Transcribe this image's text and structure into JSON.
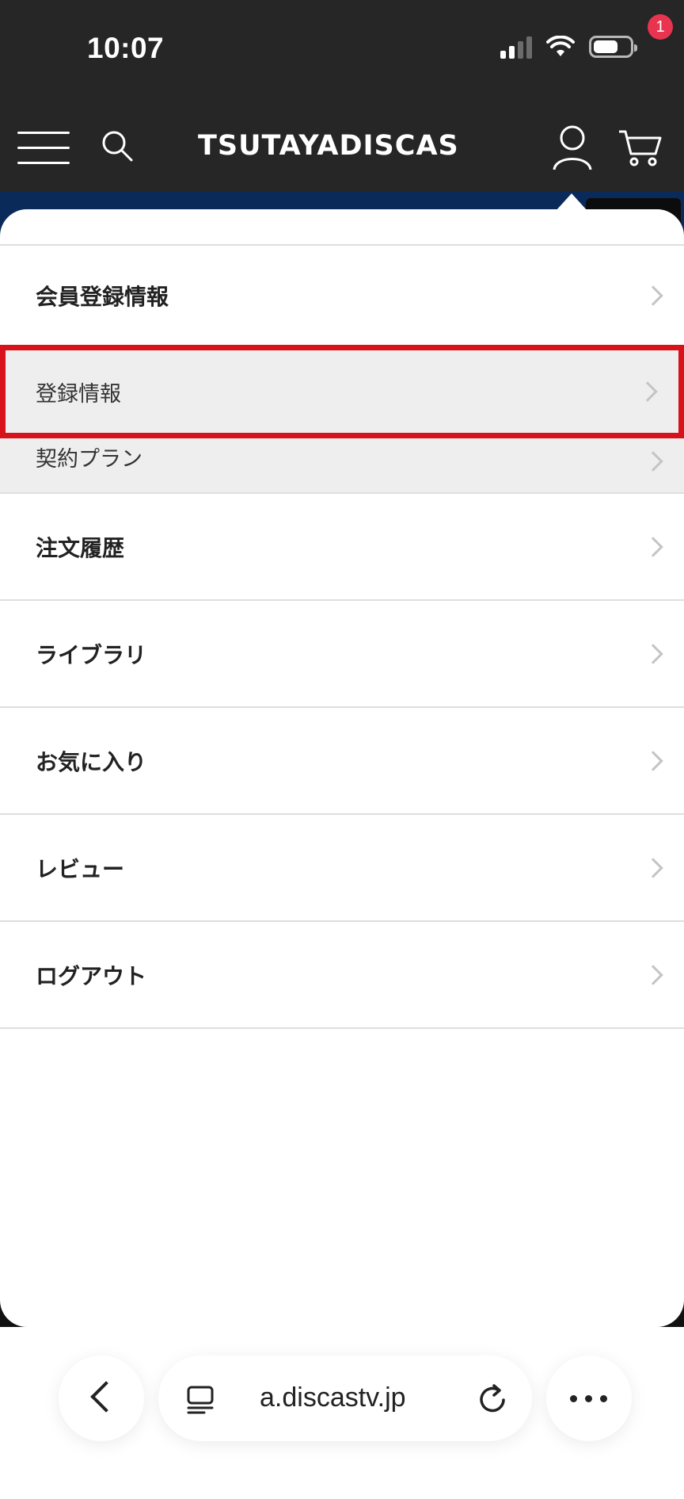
{
  "status_bar": {
    "time": "10:07"
  },
  "header": {
    "logo": "TSUTAYADISCAS",
    "cart_count": "1"
  },
  "menu": {
    "section_title": "会員登録情報",
    "sub_items": [
      {
        "label": "登録情報",
        "highlighted": true
      },
      {
        "label": "契約プラン"
      }
    ],
    "items": [
      {
        "label": "注文履歴"
      },
      {
        "label": "ライブラリ"
      },
      {
        "label": "お気に入り"
      },
      {
        "label": "レビュー"
      },
      {
        "label": "ログアウト"
      }
    ]
  },
  "browser": {
    "url": "a.discastv.jp"
  },
  "colors": {
    "header_bg": "#262626",
    "highlight_border": "#d8121b",
    "badge": "#e8344e",
    "submenu_bg": "#eeeeee"
  },
  "icons": [
    "menu-icon",
    "search-icon",
    "user-icon",
    "cart-icon",
    "chevron-right-icon",
    "back-icon",
    "tabs-icon",
    "reload-icon",
    "more-icon"
  ]
}
